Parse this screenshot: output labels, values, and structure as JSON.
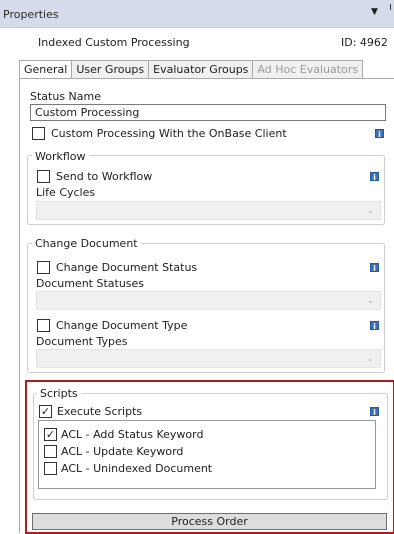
{
  "titlebar": {
    "title": "Properties",
    "dropdown_glyph": "▼"
  },
  "header": {
    "process_name": "Indexed Custom Processing",
    "id_label": "ID: 4962"
  },
  "tabs": [
    {
      "label": "General"
    },
    {
      "label": "User Groups"
    },
    {
      "label": "Evaluator Groups"
    },
    {
      "label": "Ad Hoc Evaluators"
    }
  ],
  "general": {
    "status_name_label": "Status Name",
    "status_name_value": "Custom Processing",
    "onbase_client_label": "Custom Processing With the OnBase Client"
  },
  "workflow": {
    "legend": "Workflow",
    "send_label": "Send to Workflow",
    "life_cycles_label": "Life Cycles"
  },
  "change_document": {
    "legend": "Change Document",
    "status_label": "Change Document Status",
    "statuses_label": "Document Statuses",
    "type_label": "Change Document Type",
    "types_label": "Document Types"
  },
  "scripts": {
    "legend": "Scripts",
    "execute_label": "Execute Scripts",
    "execute_checked": true,
    "items": [
      {
        "label": "ACL - Add Status Keyword",
        "checked": true
      },
      {
        "label": "ACL - Update Keyword",
        "checked": false
      },
      {
        "label": "ACL - Unindexed Document",
        "checked": false
      }
    ],
    "process_order_label": "Process Order"
  },
  "icons": {
    "dropdown": "chevron-down-icon",
    "info": "info-icon",
    "check": "checkmark-icon"
  },
  "colors": {
    "highlight": "#b01c1c",
    "titlebar": "#d6dbe9",
    "info_icon": "#3d6fb3"
  }
}
